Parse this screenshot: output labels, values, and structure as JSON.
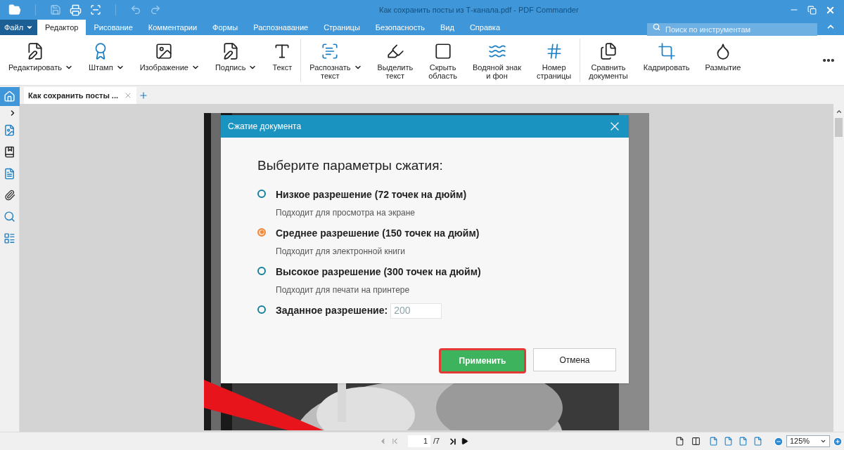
{
  "window": {
    "title": "Как сохранить посты из Т-канала.pdf - PDF Commander"
  },
  "menu": [
    {
      "label": "Файл",
      "kind": "file",
      "selected": false
    },
    {
      "label": "Редактор",
      "kind": "tab",
      "selected": true
    },
    {
      "label": "Рисование",
      "kind": "tab",
      "selected": false
    },
    {
      "label": "Комментарии",
      "kind": "tab",
      "selected": false
    },
    {
      "label": "Формы",
      "kind": "tab",
      "selected": false
    },
    {
      "label": "Распознавание",
      "kind": "tab",
      "selected": false
    },
    {
      "label": "Страницы",
      "kind": "tab",
      "selected": false
    },
    {
      "label": "Безопасность",
      "kind": "tab",
      "selected": false
    },
    {
      "label": "Вид",
      "kind": "tab",
      "selected": false
    },
    {
      "label": "Справка",
      "kind": "tab",
      "selected": false
    }
  ],
  "search": {
    "placeholder": "Поиск по инструментам"
  },
  "ribbon": [
    [
      {
        "label": "Редактировать",
        "dropdown": true
      },
      {
        "label": "Штамп",
        "dropdown": true
      },
      {
        "label": "Изображение",
        "dropdown": true
      },
      {
        "label": "Подпись",
        "dropdown": true
      },
      {
        "label": "Текст",
        "dropdown": false
      }
    ],
    [
      {
        "label": "Распознать\nтекст",
        "dropdown": true
      },
      {
        "label": "Выделить\nтекст",
        "dropdown": false
      },
      {
        "label": "Скрыть\nобласть",
        "dropdown": false
      },
      {
        "label": "Водяной знак\nи фон",
        "dropdown": false
      },
      {
        "label": "Номер\nстраницы",
        "dropdown": false
      }
    ],
    [
      {
        "label": "Сравнить\nдокументы",
        "dropdown": false
      },
      {
        "label": "Кадрировать",
        "dropdown": false
      },
      {
        "label": "Размытие",
        "dropdown": false
      }
    ]
  ],
  "doc_tabs": [
    {
      "label": "Как сохранить посты ...",
      "selected": true
    }
  ],
  "dialog": {
    "title": "Сжатие документа",
    "heading": "Выберите параметры сжатия:",
    "options": [
      {
        "kind": "preset",
        "label": "Низкое разрешение (72 точек на дюйм)",
        "hint": "Подходит для просмотра на экране",
        "selected": false
      },
      {
        "kind": "preset",
        "label": "Среднее разрешение (150 точек на дюйм)",
        "hint": "Подходит для электронной книги",
        "selected": true
      },
      {
        "kind": "preset",
        "label": "Высокое разрешение (300 точек на дюйм)",
        "hint": "Подходит для печати на принтере",
        "selected": false
      },
      {
        "kind": "custom",
        "label": "Заданное разрешение:",
        "value": "200",
        "selected": false
      }
    ],
    "buttons": [
      {
        "label": "Применить",
        "kind": "primary"
      },
      {
        "label": "Отмена",
        "kind": "secondary"
      }
    ]
  },
  "pager": {
    "page": "1",
    "total": "/7"
  },
  "zoom": {
    "value": "125%"
  }
}
